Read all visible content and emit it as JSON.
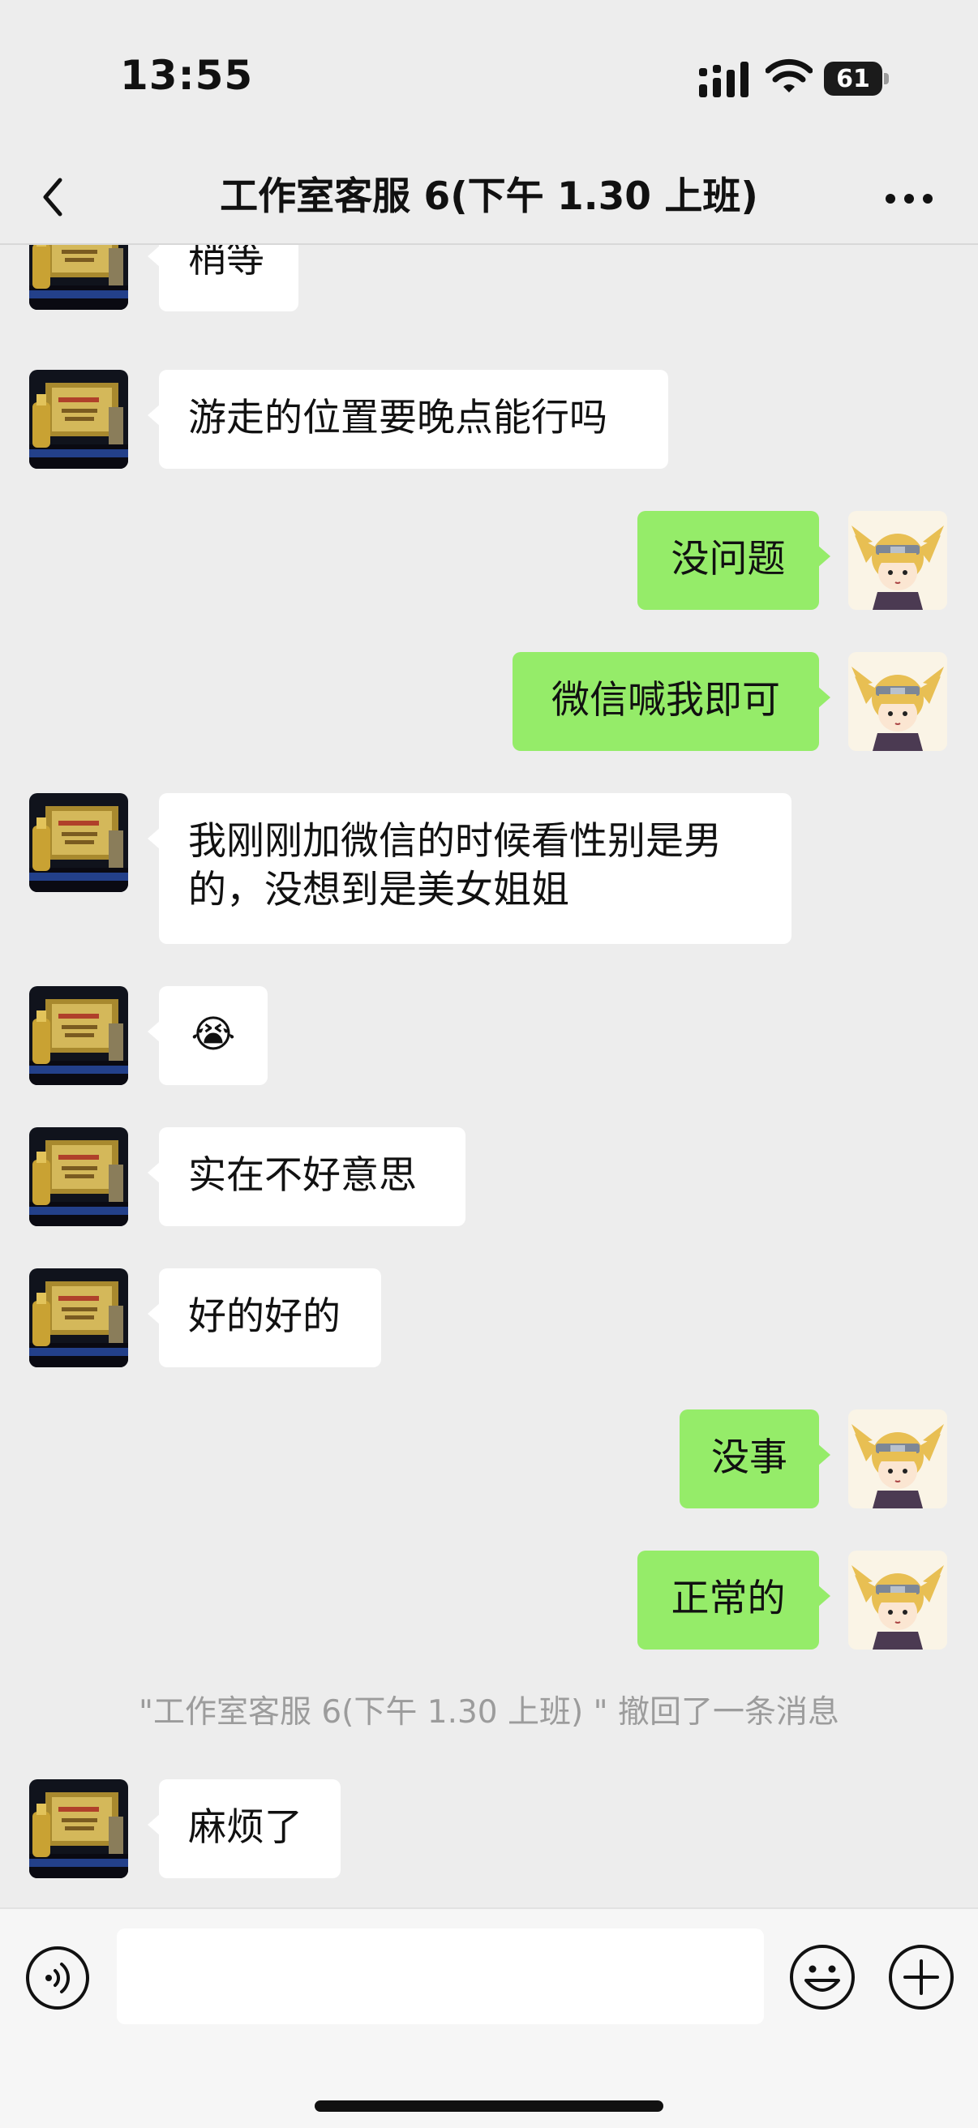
{
  "status_bar": {
    "time": "13:55",
    "battery": "61"
  },
  "nav": {
    "title": "工作室客服 6(下午 1.30 上班)"
  },
  "colors": {
    "me_bubble": "#95ec69",
    "other_bubble": "#ffffff",
    "background": "#ededed"
  },
  "messages": [
    {
      "from": "other",
      "text": "稍等"
    },
    {
      "from": "other",
      "text": "游走的位置要晚点能行吗"
    },
    {
      "from": "me",
      "text": "没问题"
    },
    {
      "from": "me",
      "text": "微信喊我即可"
    },
    {
      "from": "other",
      "lines": [
        "我刚刚加微信的时候看性别是男",
        "的，没想到是美女姐姐"
      ]
    },
    {
      "from": "other",
      "text": "😭"
    },
    {
      "from": "other",
      "text": "实在不好意思"
    },
    {
      "from": "other",
      "text": "好的好的"
    },
    {
      "from": "me",
      "text": "没事"
    },
    {
      "from": "me",
      "text": "正常的"
    },
    {
      "from": "other",
      "text": "麻烦了"
    }
  ],
  "system": {
    "recall_notice": "\"工作室客服 6(下午 1.30 上班) \" 撤回了一条消息"
  },
  "input_bar": {
    "voice_icon": "voice-icon",
    "emoji_icon": "emoji-icon",
    "plus_icon": "plus-icon"
  }
}
